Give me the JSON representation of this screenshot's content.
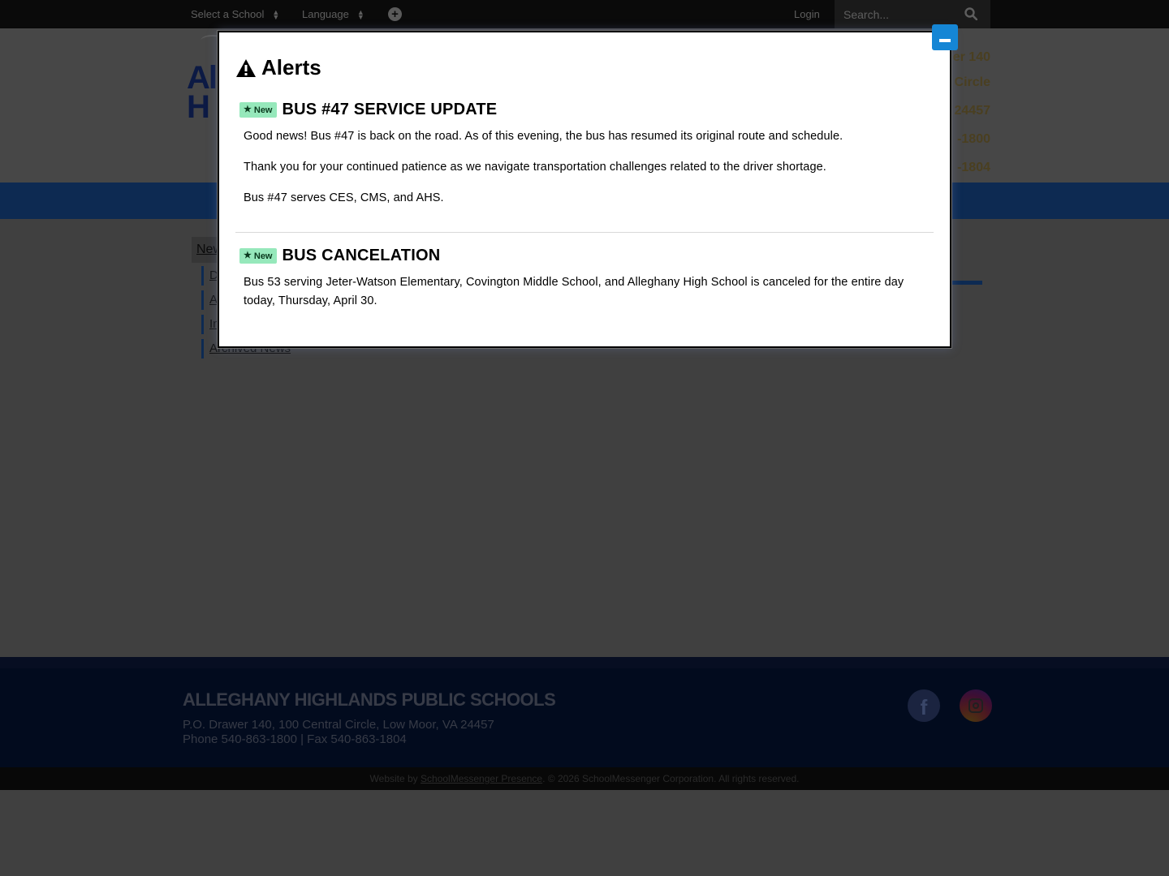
{
  "topbar": {
    "select_school": "Select a School",
    "language": "Language",
    "login": "Login",
    "search_placeholder": "Search..."
  },
  "header": {
    "logo_fragment_line1": "Al",
    "logo_fragment_line2": "H",
    "address_fragments": [
      "er 140",
      "Circle",
      "24457",
      "-1800",
      "-1804"
    ]
  },
  "sidebar": {
    "heading": "New",
    "items": [
      "D",
      "A",
      "In",
      "Archived News"
    ]
  },
  "modal": {
    "title": "Alerts",
    "alerts": [
      {
        "badge": "New",
        "title": "BUS #47 SERVICE UPDATE",
        "paragraphs": [
          "Good news! Bus #47 is back on the road. As of this evening, the bus has resumed its original route and schedule.",
          "Thank you for your continued patience as we navigate transportation challenges related to the driver shortage.",
          "Bus #47 serves CES, CMS, and AHS."
        ]
      },
      {
        "badge": "New",
        "title": "BUS CANCELATION",
        "paragraphs": [
          "Bus 53 serving Jeter-Watson Elementary, Covington Middle School, and Alleghany High School is canceled for the entire day today, Thursday, April 30."
        ]
      }
    ]
  },
  "footer": {
    "title": "ALLEGHANY HIGHLANDS PUBLIC SCHOOLS",
    "address": "P.O. Drawer 140, 100 Central Circle, Low Moor, VA 24457",
    "phone": "Phone 540-863-1800 | Fax 540-863-1804",
    "social": [
      "facebook-icon",
      "instagram-icon"
    ]
  },
  "copyright": {
    "prefix": "Website by",
    "link": "SchoolMessenger Presence",
    "suffix": ". © 2026 SchoolMessenger Corporation. All rights reserved."
  },
  "colors": {
    "modal_close": "#1586d5",
    "badge": "#96e8bb",
    "overlay_blue": "#0d2a52"
  }
}
